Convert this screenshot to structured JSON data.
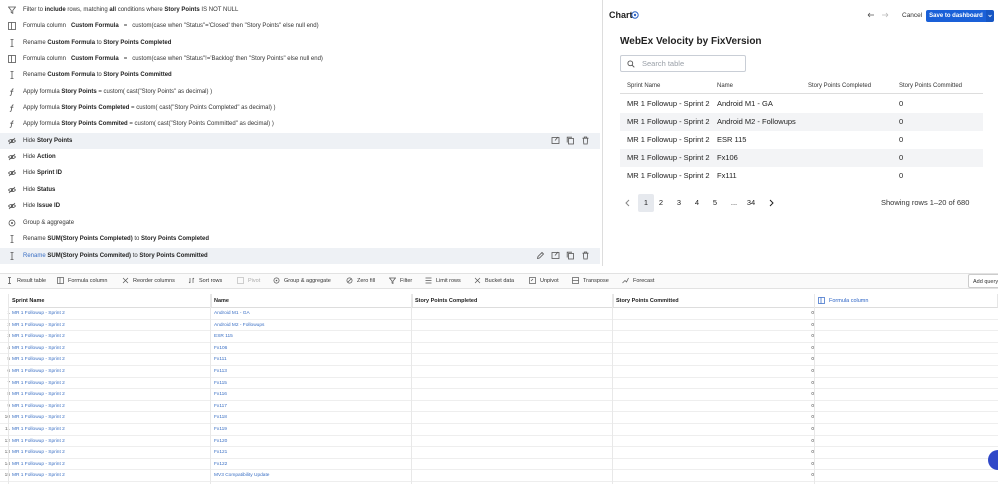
{
  "steps": [
    {
      "icon": "filter-icon",
      "parts": [
        [
          "Filter to ",
          0
        ],
        [
          "include",
          1
        ],
        [
          " rows, matching ",
          0
        ],
        [
          "all",
          1
        ],
        [
          " conditions where ",
          0
        ],
        [
          "Story Points",
          1
        ],
        [
          " IS NOT NULL",
          0
        ]
      ]
    },
    {
      "icon": "formula-column-icon",
      "parts": [
        [
          "Formula column   ",
          0
        ],
        [
          "Custom Formula",
          1
        ],
        [
          "   =   custom(case when \"Status\"='Closed' then \"Story Points\" else null end)",
          0
        ]
      ]
    },
    {
      "icon": "rename-icon",
      "parts": [
        [
          "Rename ",
          0
        ],
        [
          "Custom Formula",
          1
        ],
        [
          " to ",
          0
        ],
        [
          "Story Points Completed",
          1
        ]
      ]
    },
    {
      "icon": "formula-column-icon",
      "parts": [
        [
          "Formula column   ",
          0
        ],
        [
          "Custom Formula",
          1
        ],
        [
          "   =   custom(case when \"Status\"!='Backlog' then \"Story Points\" else null end)",
          0
        ]
      ]
    },
    {
      "icon": "rename-icon",
      "parts": [
        [
          "Rename ",
          0
        ],
        [
          "Custom Formula",
          1
        ],
        [
          " to ",
          0
        ],
        [
          "Story Points Committed",
          1
        ]
      ]
    },
    {
      "icon": "apply-formula-icon",
      "parts": [
        [
          "Apply formula ",
          0
        ],
        [
          "Story Points",
          1
        ],
        [
          " = custom( cast(\"Story Points\" as decimal) )",
          0
        ]
      ]
    },
    {
      "icon": "apply-formula-icon",
      "parts": [
        [
          "Apply formula ",
          0
        ],
        [
          "Story Points Completed",
          1
        ],
        [
          " = custom( cast(\"Story Points Completed\" as decimal) )",
          0
        ]
      ]
    },
    {
      "icon": "apply-formula-icon",
      "parts": [
        [
          "Apply formula ",
          0
        ],
        [
          "Story Points Commited",
          1
        ],
        [
          " = custom( cast(\"Story Points Committed\" as decimal) )",
          0
        ]
      ]
    },
    {
      "icon": "hide-icon",
      "parts": [
        [
          "Hide ",
          0
        ],
        [
          "Story Points",
          1
        ]
      ]
    },
    {
      "icon": "hide-icon",
      "parts": [
        [
          "Hide ",
          0
        ],
        [
          "Action",
          1
        ]
      ]
    },
    {
      "icon": "hide-icon",
      "parts": [
        [
          "Hide ",
          0
        ],
        [
          "Sprint ID",
          1
        ]
      ]
    },
    {
      "icon": "hide-icon",
      "parts": [
        [
          "Hide ",
          0
        ],
        [
          "Status",
          1
        ]
      ]
    },
    {
      "icon": "hide-icon",
      "parts": [
        [
          "Hide ",
          0
        ],
        [
          "Issue ID",
          1
        ]
      ]
    },
    {
      "icon": "group-aggregate-icon",
      "parts": [
        [
          "Group & aggregate",
          0
        ]
      ]
    },
    {
      "icon": "rename-icon",
      "parts": [
        [
          "Rename ",
          0
        ],
        [
          "SUM(Story Points Completed)",
          1
        ],
        [
          " to ",
          0
        ],
        [
          "Story Points Completed",
          1
        ]
      ]
    },
    {
      "icon": "rename-icon",
      "parts": [
        [
          "Rename",
          2
        ],
        [
          " ",
          0
        ],
        [
          "SUM(Story Points Commited)",
          1
        ],
        [
          " to ",
          0
        ],
        [
          "Story Points Committed",
          1
        ]
      ]
    }
  ],
  "chart": {
    "header": "Chart",
    "cancel": "Cancel",
    "save": "Save to dashboard",
    "title": "WebEx Velocity by FixVersion",
    "search_placeholder": "Search table",
    "columns": [
      "Sprint Name",
      "Name",
      "Story Points Completed",
      "Story Points Committed"
    ],
    "rows": [
      [
        "MR 1 Followup - Sprint 2",
        "Android M1 - GA",
        "",
        "0"
      ],
      [
        "MR 1 Followup - Sprint 2",
        "Android M2 - Followups",
        "",
        "0"
      ],
      [
        "MR 1 Followup - Sprint 2",
        "ESR 115",
        "",
        "0"
      ],
      [
        "MR 1 Followup - Sprint 2",
        "Fx106",
        "",
        "0"
      ],
      [
        "MR 1 Followup - Sprint 2",
        "Fx111",
        "",
        "0"
      ]
    ],
    "pages": [
      "1",
      "2",
      "3",
      "4",
      "5",
      "...",
      "34"
    ],
    "active_page": "1",
    "showing": "Showing rows 1–20 of 680"
  },
  "toolbar": {
    "result_table": "Result table",
    "formula_column": "Formula column",
    "reorder_columns": "Reorder columns",
    "sort_rows": "Sort rows",
    "pivot": "Pivot",
    "group_aggregate": "Group & aggregate",
    "zero_fill": "Zero fill",
    "filter": "Filter",
    "limit_rows": "Limit rows",
    "bucket_data": "Bucket data",
    "unpivot": "Unpivot",
    "transpose": "Transpose",
    "forecast": "Forecast",
    "add_query": "Add query"
  },
  "grid": {
    "headers": [
      "Sprint Name",
      "Name",
      "Story Points Completed",
      "Story Points Committed",
      "Formula column"
    ],
    "rows": [
      [
        "1",
        "MR 1 Followup - Sprint 2",
        "Android M1 - GA",
        "0"
      ],
      [
        "2",
        "MR 1 Followup - Sprint 2",
        "Android M2 - Followups",
        "0"
      ],
      [
        "3",
        "MR 1 Followup - Sprint 2",
        "ESR 115",
        "0"
      ],
      [
        "4",
        "MR 1 Followup - Sprint 2",
        "Fx106",
        "0"
      ],
      [
        "5",
        "MR 1 Followup - Sprint 2",
        "Fx111",
        "0"
      ],
      [
        "6",
        "MR 1 Followup - Sprint 2",
        "Fx113",
        "0"
      ],
      [
        "7",
        "MR 1 Followup - Sprint 2",
        "Fx115",
        "0"
      ],
      [
        "8",
        "MR 1 Followup - Sprint 2",
        "Fx116",
        "0"
      ],
      [
        "9",
        "MR 1 Followup - Sprint 2",
        "Fx117",
        "0"
      ],
      [
        "10",
        "MR 1 Followup - Sprint 2",
        "Fx118",
        "0"
      ],
      [
        "11",
        "MR 1 Followup - Sprint 2",
        "Fx119",
        "0"
      ],
      [
        "12",
        "MR 1 Followup - Sprint 2",
        "Fx120",
        "0"
      ],
      [
        "13",
        "MR 1 Followup - Sprint 2",
        "Fx121",
        "0"
      ],
      [
        "14",
        "MR 1 Followup - Sprint 2",
        "Fx122",
        "0"
      ],
      [
        "15",
        "MR 1 Followup - Sprint 2",
        "MV3 Compatibility Update",
        "0"
      ]
    ]
  }
}
